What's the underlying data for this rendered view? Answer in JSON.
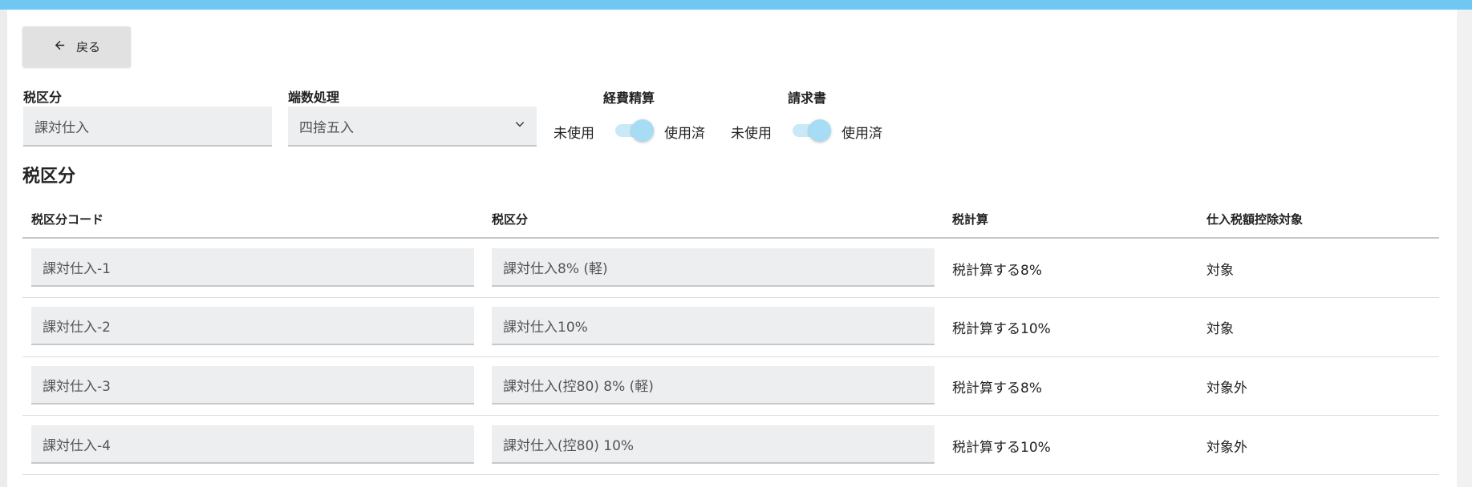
{
  "header": {
    "back_label": "戻る",
    "back_icon": "arrow-left-icon"
  },
  "form": {
    "tax_category": {
      "label": "税区分",
      "value": "課対仕入"
    },
    "rounding": {
      "label": "端数処理",
      "value": "四捨五入",
      "icon": "chevron-down-icon"
    },
    "expense_settlement": {
      "label": "経費精算",
      "off_label": "未使用",
      "on_label": "使用済",
      "checked": true
    },
    "invoice": {
      "label": "請求書",
      "off_label": "未使用",
      "on_label": "使用済",
      "checked": true
    }
  },
  "table": {
    "title": "税区分",
    "columns": [
      "税区分コード",
      "税区分",
      "税計算",
      "仕入税額控除対象"
    ],
    "rows": [
      {
        "code": "課対仕入-1",
        "category": "課対仕入8% (軽)",
        "calc": "税計算する8%",
        "deductible": "対象"
      },
      {
        "code": "課対仕入-2",
        "category": "課対仕入10%",
        "calc": "税計算する10%",
        "deductible": "対象"
      },
      {
        "code": "課対仕入-3",
        "category": "課対仕入(控80) 8% (軽)",
        "calc": "税計算する8%",
        "deductible": "対象外"
      },
      {
        "code": "課対仕入-4",
        "category": "課対仕入(控80) 10%",
        "calc": "税計算する10%",
        "deductible": "対象外"
      }
    ]
  },
  "colors": {
    "accent": "#6ec8f2",
    "toggle_knob": "#a7dcf5",
    "field_bg": "#eceeef"
  }
}
